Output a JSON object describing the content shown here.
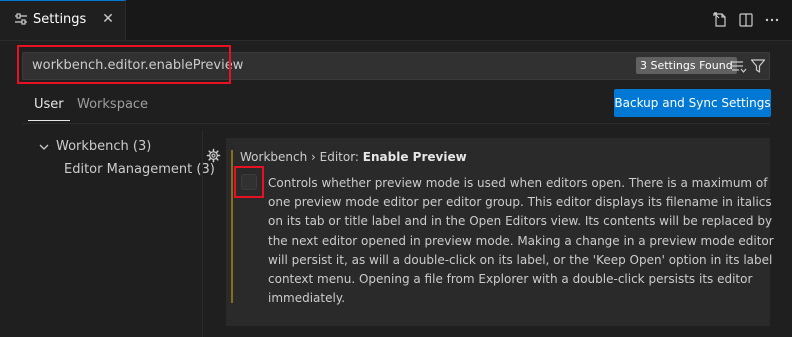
{
  "tab": {
    "title": "Settings",
    "close": "✕"
  },
  "search": {
    "value": "workbench.editor.enablePreview",
    "results_badge": "3 Settings Found"
  },
  "scopes": {
    "user": "User",
    "workspace": "Workspace"
  },
  "sync_button": "Backup and Sync Settings",
  "toc": {
    "workbench": "Workbench (3)",
    "editor_management": "Editor Management (3)"
  },
  "setting": {
    "category": "Workbench › Editor: ",
    "name": "Enable Preview",
    "checked": false,
    "description_lines": [
      "Controls whether preview mode is used when editors open. There is a maximum of",
      "one preview mode editor per editor group. This editor displays its filename in italics",
      "on its tab or title label and in the Open Editors view. Its contents will be replaced by",
      "the next editor opened in preview mode. Making a change in a preview mode editor",
      "will persist it, as will a double-click on its label, or the 'Keep Open' option in its label",
      "context menu. Opening a file from Explorer with a double-click persists its editor",
      "immediately."
    ]
  },
  "colors": {
    "accent": "#0078d4",
    "highlight": "#e81123",
    "modified_indicator": "#8a6d21"
  },
  "icons": [
    "settings-icon",
    "close-icon",
    "open-json-icon",
    "split-editor-icon",
    "more-actions-icon",
    "sort-icon",
    "filter-icon",
    "chevron-down-icon",
    "gear-icon"
  ]
}
